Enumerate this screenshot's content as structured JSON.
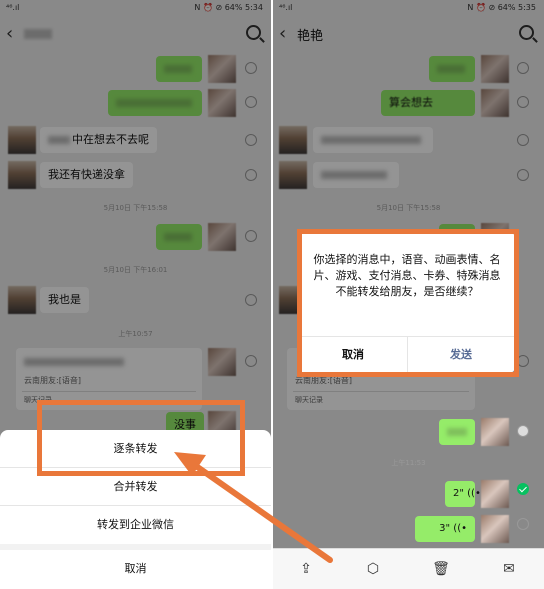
{
  "left": {
    "status": {
      "left": "⁴⁶.ıl",
      "right": "N ⏰ ⊘ 64% 5:34"
    },
    "header": {
      "back": "‹",
      "title": ""
    },
    "messages": {
      "m3": "中在想去不去呢",
      "m4": "我还有快递没拿",
      "ts1": "5月10日 下午15:58",
      "ts2": "5月10日 下午16:01",
      "m6": "我也是",
      "ts3": "上午10:57",
      "card_sub": "云南朋友:[语音]",
      "card_footer": "聊天记录",
      "m8": "没事"
    },
    "sheet": {
      "option1": "逐条转发",
      "option2": "合并转发",
      "option3": "转发到企业微信",
      "cancel": "取消"
    }
  },
  "right": {
    "status": {
      "left": "⁴⁶.ıl",
      "right": "N ⏰ ⊘ 64% 5:35"
    },
    "header": {
      "back": "‹",
      "title": "艳艳"
    },
    "messages": {
      "m2": "算会想去",
      "ts1": "5月10日 下午15:58",
      "card_sub": "云南朋友:[语音]",
      "card_footer": "聊天记录",
      "ts2": "上午11:53",
      "voice1": "2\" ((•",
      "voice2": "3\" ((•"
    },
    "dialog": {
      "message": "你选择的消息中，语音、动画表情、名片、游戏、支付消息、卡券、特殊消息不能转发给朋友，是否继续？",
      "cancel": "取消",
      "confirm": "发送"
    },
    "toolbar_icons": [
      "share-icon",
      "cube-icon",
      "trash-icon",
      "mail-icon"
    ]
  },
  "colors": {
    "accent_orange": "#e9773a",
    "bubble_green": "#95ec69",
    "wechat_green": "#07c160",
    "link_blue": "#576b95"
  }
}
